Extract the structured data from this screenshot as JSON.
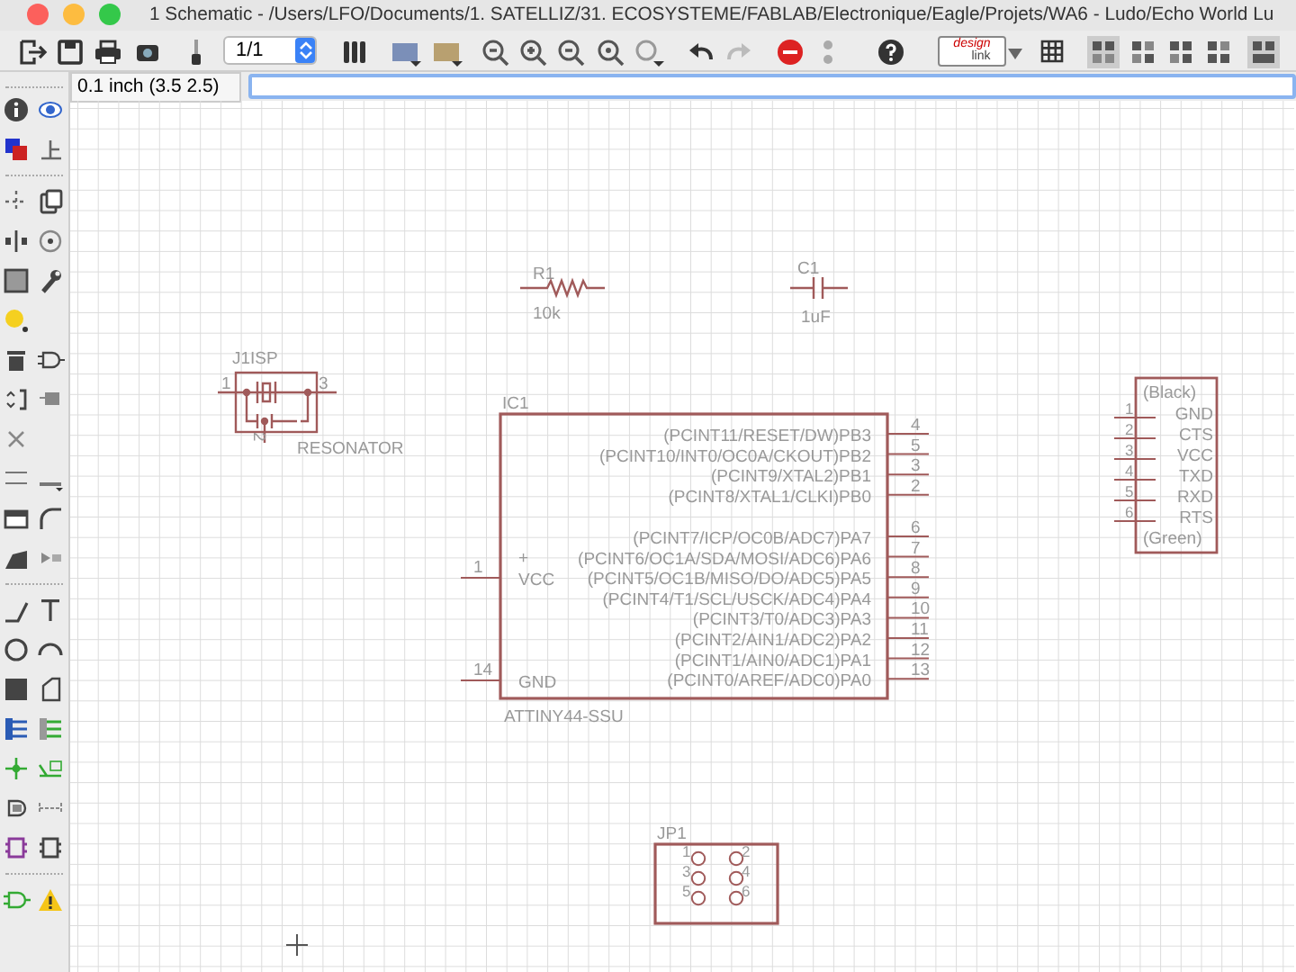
{
  "window": {
    "title": "1 Schematic - /Users/LFO/Documents/1. SATELLIZ/31. ECOSYSTEME/FABLAB/Electronique/Eagle/Projets/WA6 - Ludo/Echo World Lu"
  },
  "toolbar": {
    "sheet_field": "1/1",
    "logo": [
      "design",
      "link"
    ]
  },
  "coordinate_bar": {
    "coordinates": "0.1 inch (3.5 2.5)"
  },
  "parts": [
    {
      "kind": "resistor",
      "name": "R1",
      "value": "10k"
    },
    {
      "kind": "capacitor",
      "name": "C1",
      "value": "1uF"
    },
    {
      "kind": "resonator",
      "name": "J1ISP",
      "value": "RESONATOR",
      "pins": [
        "1",
        "3",
        "2"
      ]
    },
    {
      "kind": "ic",
      "name": "IC1",
      "value": "ATTINY44-SSU",
      "left_pins": [
        {
          "mark": "+",
          "label": "VCC",
          "number": "1"
        },
        {
          "label": "GND",
          "number": "14"
        }
      ],
      "right_pins": [
        {
          "label": "(PCINT11/RESET/DW)PB3",
          "number": "4"
        },
        {
          "label": "(PCINT10/INT0/OC0A/CKOUT)PB2",
          "number": "5"
        },
        {
          "label": "(PCINT9/XTAL2)PB1",
          "number": "3"
        },
        {
          "label": "(PCINT8/XTAL1/CLKI)PB0",
          "number": "2"
        },
        {
          "label": "(PCINT7/ICP/OC0B/ADC7)PA7",
          "number": "6"
        },
        {
          "label": "(PCINT6/OC1A/SDA/MOSI/ADC6)PA6",
          "number": "7"
        },
        {
          "label": "(PCINT5/OC1B/MISO/DO/ADC5)PA5",
          "number": "8"
        },
        {
          "label": "(PCINT4/T1/SCL/USCK/ADC4)PA4",
          "number": "9"
        },
        {
          "label": "(PCINT3/T0/ADC3)PA3",
          "number": "10"
        },
        {
          "label": "(PCINT2/AIN1/ADC2)PA2",
          "number": "11"
        },
        {
          "label": "(PCINT1/AIN0/ADC1)PA1",
          "number": "12"
        },
        {
          "label": "(PCINT0/AREF/ADC0)PA0",
          "number": "13"
        }
      ]
    },
    {
      "kind": "connector",
      "top": "(Black)",
      "bottom": "(Green)",
      "pins": [
        {
          "label": "GND",
          "number": "1"
        },
        {
          "label": "CTS",
          "number": "2"
        },
        {
          "label": "VCC",
          "number": "3"
        },
        {
          "label": "TXD",
          "number": "4"
        },
        {
          "label": "RXD",
          "number": "5"
        },
        {
          "label": "RTS",
          "number": "6"
        }
      ]
    },
    {
      "kind": "header",
      "name": "JP1",
      "pins": [
        "1",
        "2",
        "3",
        "4",
        "5",
        "6"
      ]
    }
  ]
}
